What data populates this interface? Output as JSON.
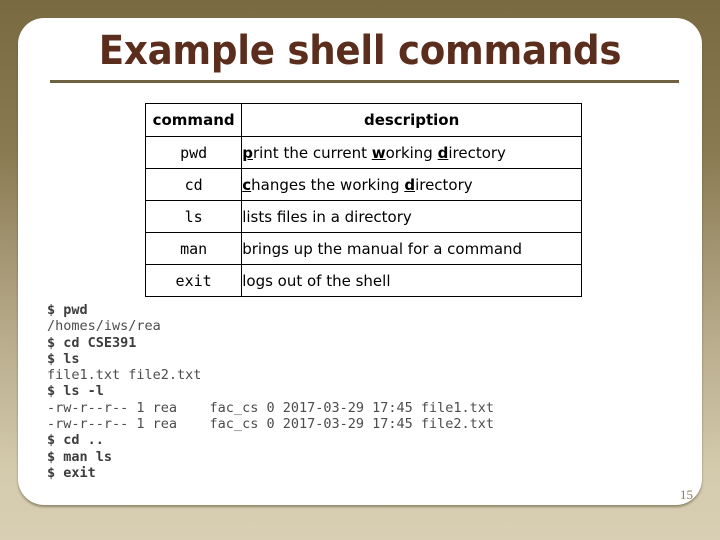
{
  "slide": {
    "title": "Example shell commands",
    "page_number": "15"
  },
  "table": {
    "headers": [
      "command",
      "description"
    ],
    "rows": [
      {
        "command": "pwd",
        "description": "print the current working directory",
        "description_html": "<u>p</u>rint the current <u>w</u>orking <u>d</u>irectory"
      },
      {
        "command": "cd",
        "description": "changes the working directory",
        "description_html": "<u>c</u>hanges the working <u>d</u>irectory"
      },
      {
        "command": "ls",
        "description": "lists files in a directory",
        "description_html": "lists files in a directory"
      },
      {
        "command": "man",
        "description": "brings up the manual for a command",
        "description_html": "brings up the manual for a command"
      },
      {
        "command": "exit",
        "description": "logs out of the shell",
        "description_html": "logs out of the shell"
      }
    ]
  },
  "terminal": {
    "lines": [
      {
        "type": "command",
        "text": "$ pwd"
      },
      {
        "type": "output",
        "text": "/homes/iws/rea"
      },
      {
        "type": "command",
        "text": "$ cd CSE391"
      },
      {
        "type": "command",
        "text": "$ ls"
      },
      {
        "type": "output",
        "text": "file1.txt file2.txt"
      },
      {
        "type": "command",
        "text": "$ ls -l"
      },
      {
        "type": "output",
        "text": "-rw-r--r-- 1 rea    fac_cs 0 2017-03-29 17:45 file1.txt"
      },
      {
        "type": "output",
        "text": "-rw-r--r-- 1 rea    fac_cs 0 2017-03-29 17:45 file2.txt"
      },
      {
        "type": "command",
        "text": "$ cd .."
      },
      {
        "type": "command",
        "text": "$ man ls"
      },
      {
        "type": "command",
        "text": "$ exit"
      }
    ]
  },
  "colors": {
    "title": "#5b2d1c",
    "rule": "#6f6242",
    "background_top": "#7a6a42",
    "background_bottom": "#d8cfb4",
    "panel": "#ffffff",
    "terminal_text": "#4c4c4c",
    "page_number": "#8a7c58"
  }
}
